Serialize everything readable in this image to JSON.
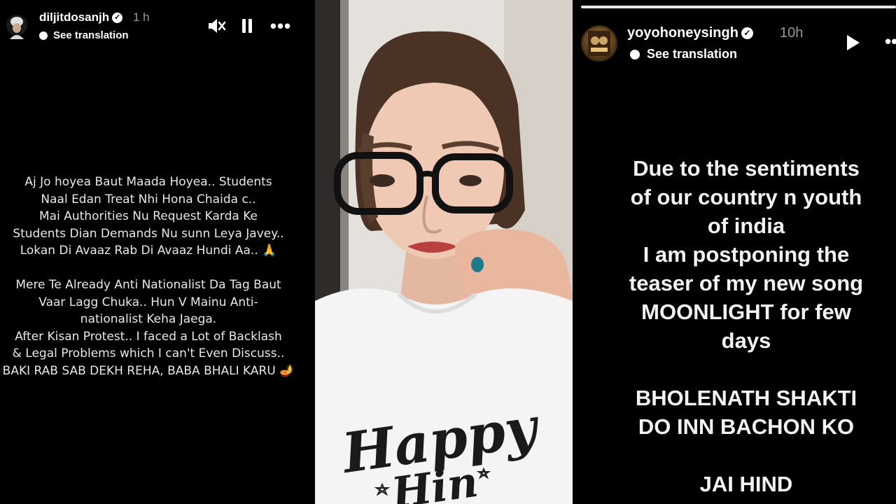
{
  "left_story": {
    "username": "diljitdosanjh",
    "time": "1 h",
    "see_translation": "See translation",
    "icons": [
      "mute-icon",
      "pause-icon",
      "more-icon"
    ],
    "text": "Aj Jo hoyea Baut Maada Hoyea.. Students\nNaal Edan Treat Nhi Hona Chaida c..\nMai Authorities Nu Request Karda Ke\nStudents Dian Demands Nu sunn Leya Javey..\nLokan Di Avaaz Rab Di Avaaz Hundi Aa.. 🙏\n\nMere Te Already Anti Nationalist Da Tag Baut\nVaar Lagg Chuka.. Hun V Mainu Anti-\nnationalist Keha Jaega.\nAfter Kisan Protest.. I faced a Lot of Backlash\n& Legal Problems which I can't Even Discuss..\nBAKI RAB SAB DEKH REHA, BABA BHALI KARU 🪔"
  },
  "middle_photo": {
    "shirt_text": "Happy"
  },
  "right_story": {
    "username": "yoyohoneysingh",
    "time": "10h",
    "see_translation": "See translation",
    "icons": [
      "play-icon",
      "more-icon"
    ],
    "text": "Due to the sentiments\nof our country n youth\nof india\nI am postponing the\nteaser of  my new song\nMOONLIGHT for few\ndays\n\nBHOLENATH SHAKTI\nDO INN BACHON KO\n\nJAI HIND"
  }
}
